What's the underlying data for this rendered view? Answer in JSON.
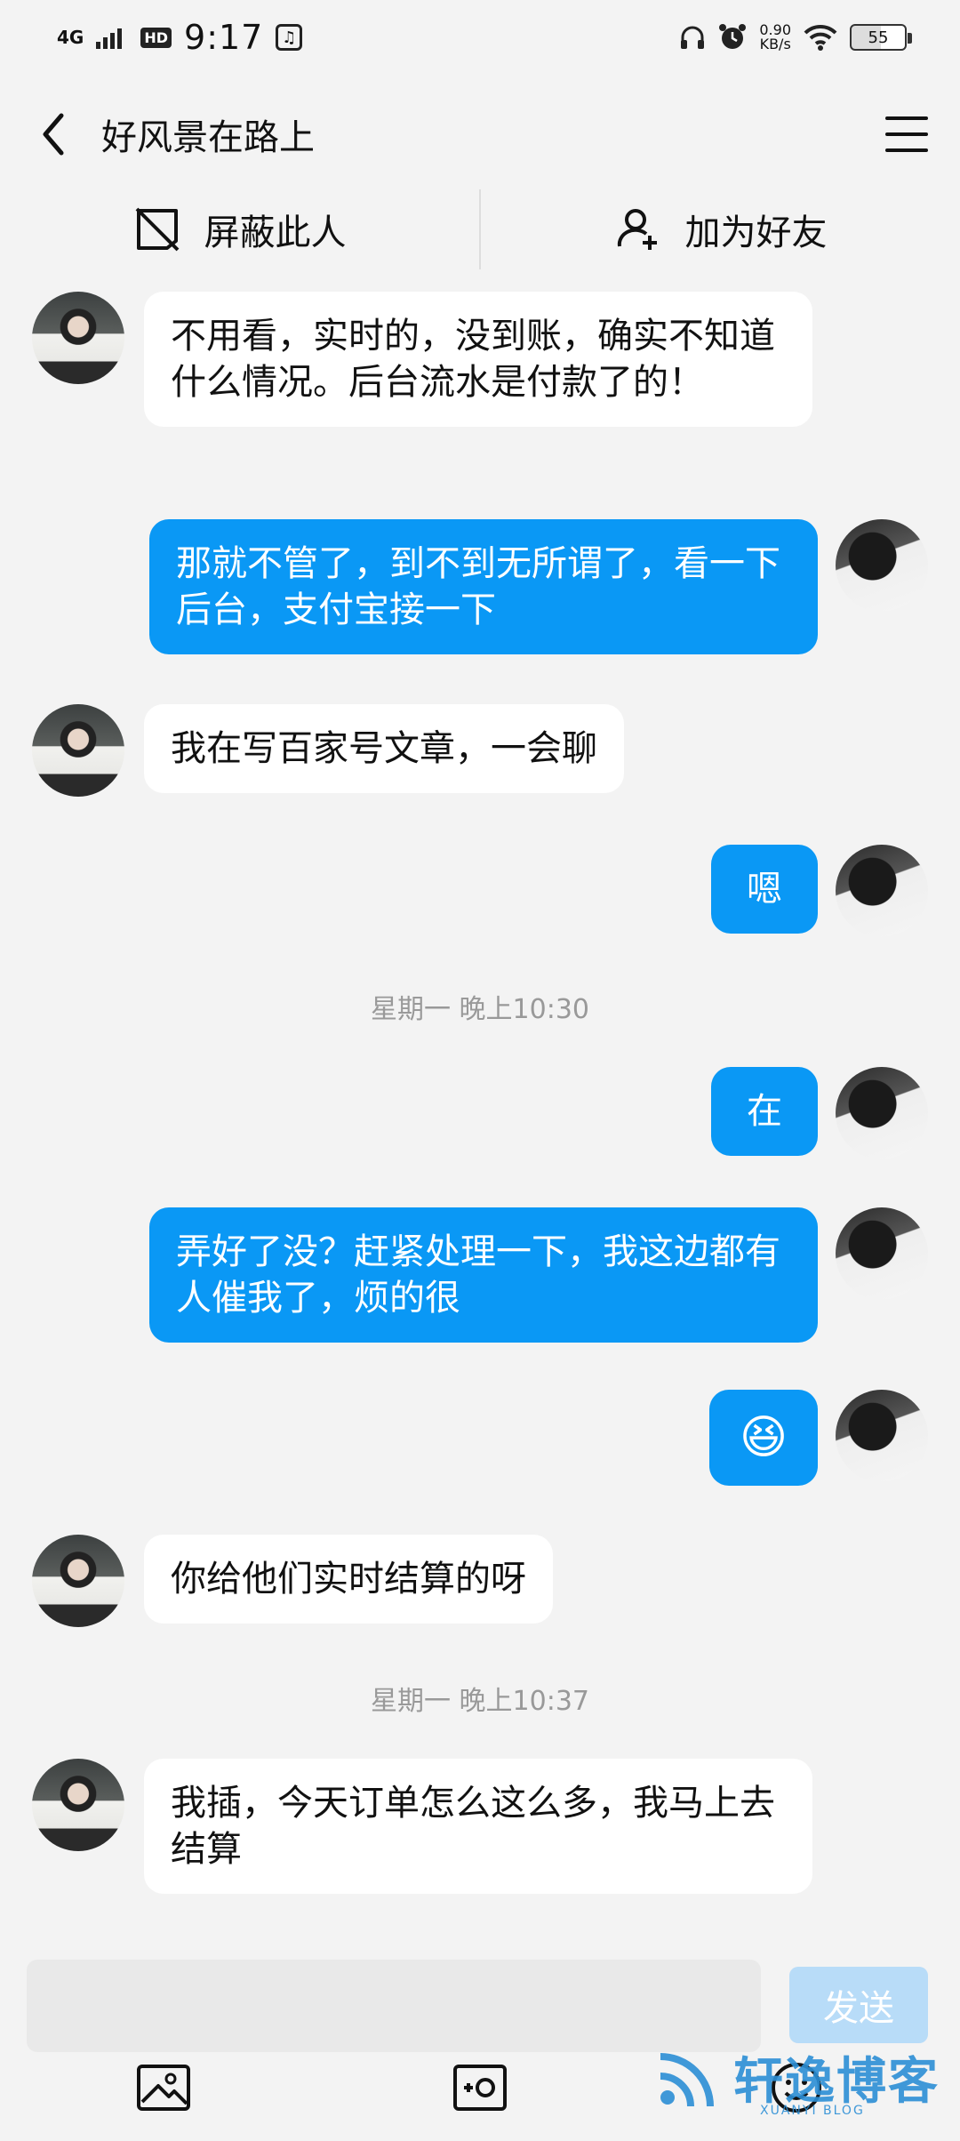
{
  "status_bar": {
    "network": "4G",
    "hd": "HD",
    "time": "9:17",
    "music": "♫",
    "speed_value": "0.90",
    "speed_unit": "KB/s",
    "battery": "55"
  },
  "header": {
    "title": "好风景在路上"
  },
  "actions": {
    "block": "屏蔽此人",
    "add_friend": "加为好友"
  },
  "messages": [
    {
      "side": "in",
      "text": "不用看，实时的，没到账，确实不知道什么情况。后台流水是付款了的！"
    },
    {
      "side": "out",
      "text": "那就不管了，到不到无所谓了，看一下后台，支付宝接一下"
    },
    {
      "side": "in",
      "text": "我在写百家号文章，一会聊"
    },
    {
      "side": "out",
      "text": "嗯"
    },
    {
      "side": "out",
      "text": "在"
    },
    {
      "side": "out",
      "text": "弄好了没？赶紧处理一下，我这边都有人催我了，烦的很"
    },
    {
      "side": "out",
      "text": "😆",
      "emoji": "laughing-face-icon"
    },
    {
      "side": "in",
      "text": "你给他们实时结算的呀"
    },
    {
      "side": "in",
      "text": "我插，今天订单怎么这么多，我马上去结算"
    }
  ],
  "timestamps": [
    "星期一 晚上10:30",
    "星期一 晚上10:37"
  ],
  "input": {
    "placeholder": "",
    "send_label": "发送"
  },
  "watermark": {
    "text": "轩逸博客",
    "sub": "XUANYI BLOG"
  },
  "colors": {
    "outgoing_bubble": "#0a98f5",
    "incoming_bubble": "#ffffff",
    "background": "#f3f3f3",
    "send_button_disabled": "#b8dcf8"
  }
}
